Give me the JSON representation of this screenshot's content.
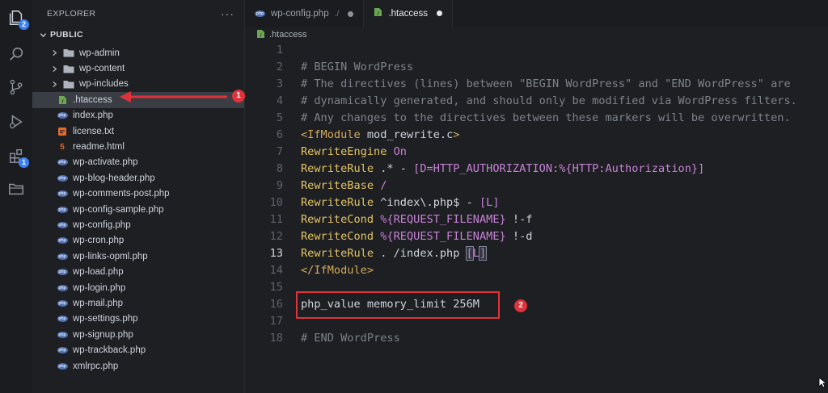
{
  "sidebar": {
    "title": "EXPLORER",
    "more": "···",
    "root": "PUBLIC",
    "items": [
      {
        "label": "wp-admin",
        "kind": "folder"
      },
      {
        "label": "wp-content",
        "kind": "folder"
      },
      {
        "label": "wp-includes",
        "kind": "folder"
      },
      {
        "label": ".htaccess",
        "kind": "htaccess",
        "selected": true
      },
      {
        "label": "index.php",
        "kind": "php"
      },
      {
        "label": "license.txt",
        "kind": "license"
      },
      {
        "label": "readme.html",
        "kind": "html"
      },
      {
        "label": "wp-activate.php",
        "kind": "php"
      },
      {
        "label": "wp-blog-header.php",
        "kind": "php"
      },
      {
        "label": "wp-comments-post.php",
        "kind": "php"
      },
      {
        "label": "wp-config-sample.php",
        "kind": "php"
      },
      {
        "label": "wp-config.php",
        "kind": "php"
      },
      {
        "label": "wp-cron.php",
        "kind": "php"
      },
      {
        "label": "wp-links-opml.php",
        "kind": "php"
      },
      {
        "label": "wp-load.php",
        "kind": "php"
      },
      {
        "label": "wp-login.php",
        "kind": "php"
      },
      {
        "label": "wp-mail.php",
        "kind": "php"
      },
      {
        "label": "wp-settings.php",
        "kind": "php"
      },
      {
        "label": "wp-signup.php",
        "kind": "php"
      },
      {
        "label": "wp-trackback.php",
        "kind": "php"
      },
      {
        "label": "xmlrpc.php",
        "kind": "php"
      }
    ]
  },
  "activity": {
    "explorer_badge": "2",
    "extensions_badge": "1"
  },
  "tabs": [
    {
      "label": "wp-config.php",
      "hint": "./",
      "active": false
    },
    {
      "label": ".htaccess",
      "hint": "",
      "active": true
    }
  ],
  "breadcrumb": ".htaccess",
  "editor": {
    "current_line": 13,
    "lines": [
      {
        "n": "1",
        "t": ""
      },
      {
        "n": "2",
        "t": "# BEGIN WordPress"
      },
      {
        "n": "3",
        "t": "# The directives (lines) between \"BEGIN WordPress\" and \"END WordPress\" are"
      },
      {
        "n": "4",
        "t": "# dynamically generated, and should only be modified via WordPress filters."
      },
      {
        "n": "5",
        "t": "# Any changes to the directives between these markers will be overwritten."
      },
      {
        "n": "6",
        "t": "<IfModule mod_rewrite.c>"
      },
      {
        "n": "7",
        "t": "RewriteEngine On"
      },
      {
        "n": "8",
        "t": "RewriteRule .* - [D=HTTP_AUTHORIZATION:%{HTTP:Authorization}]"
      },
      {
        "n": "9",
        "t": "RewriteBase /"
      },
      {
        "n": "10",
        "t": "RewriteRule ^index\\.php$ - [L]"
      },
      {
        "n": "11",
        "t": "RewriteCond %{REQUEST_FILENAME} !-f"
      },
      {
        "n": "12",
        "t": "RewriteCond %{REQUEST_FILENAME} !-d"
      },
      {
        "n": "13",
        "t": "RewriteRule . /index.php [L]"
      },
      {
        "n": "14",
        "t": "</IfModule>"
      },
      {
        "n": "15",
        "t": ""
      },
      {
        "n": "16",
        "t": "php_value memory_limit 256M"
      },
      {
        "n": "17",
        "t": ""
      },
      {
        "n": "18",
        "t": "# END WordPress"
      }
    ]
  },
  "annotations": {
    "step1": "1",
    "step2": "2",
    "color": "#e0323a"
  }
}
